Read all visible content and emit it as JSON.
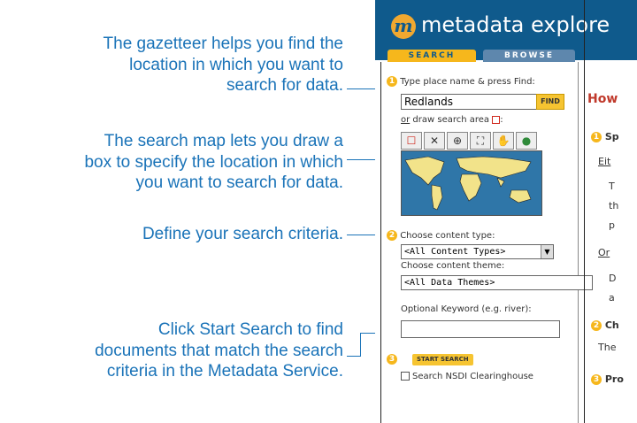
{
  "callouts": [
    {
      "lines": [
        "The gazetteer helps you find the",
        "location in which you want to",
        "search for data."
      ]
    },
    {
      "lines": [
        "The search map lets you draw a",
        "box to specify the location in which",
        "you want to search for data."
      ]
    },
    {
      "lines": [
        "Define your search criteria."
      ]
    },
    {
      "lines": [
        "Click Start Search to find",
        "documents that match the search",
        "criteria in the Metadata Service."
      ]
    }
  ],
  "app": {
    "title": "metadata explore",
    "logo_letter": "m"
  },
  "tabs": [
    {
      "label": "SEARCH"
    },
    {
      "label": "BROWSE"
    }
  ],
  "panel": {
    "step1_num": "1",
    "step1_label": "Type place name & press Find:",
    "place_value": "Redlands",
    "find_label": "FIND",
    "draw_or": "or",
    "draw_label": " draw search area ",
    "draw_colon": ":",
    "tools": [
      "☐",
      "✕",
      "⊕",
      "⛶",
      "✋",
      "●"
    ],
    "step2_num": "2",
    "content_type_label": "Choose content type:",
    "content_type_value": "<All Content Types>",
    "content_theme_label": "Choose content theme:",
    "content_theme_value": "<All Data Themes>",
    "keyword_label": "Optional Keyword (e.g. river):",
    "keyword_value": "",
    "step3_num": "3",
    "start_label": "START SEARCH",
    "nsdi_label": "Search NSDI Clearinghouse"
  },
  "help": {
    "title": "How",
    "s1_num": "1",
    "s1_title": "Sp",
    "s1_either": "Eit",
    "s1_l1": "T",
    "s1_l2": "th",
    "s1_l3": "p",
    "s1_or": "Or",
    "s1_l4": "D",
    "s1_l5": "a",
    "s2_num": "2",
    "s2_title": "Ch",
    "s2_l1": "The",
    "s3_num": "3",
    "s3_title": "Pro"
  },
  "colors": {
    "accent": "#1a73b8",
    "header": "#0f5a8c",
    "highlight": "#f6b71c",
    "help_title": "#c0392b"
  }
}
